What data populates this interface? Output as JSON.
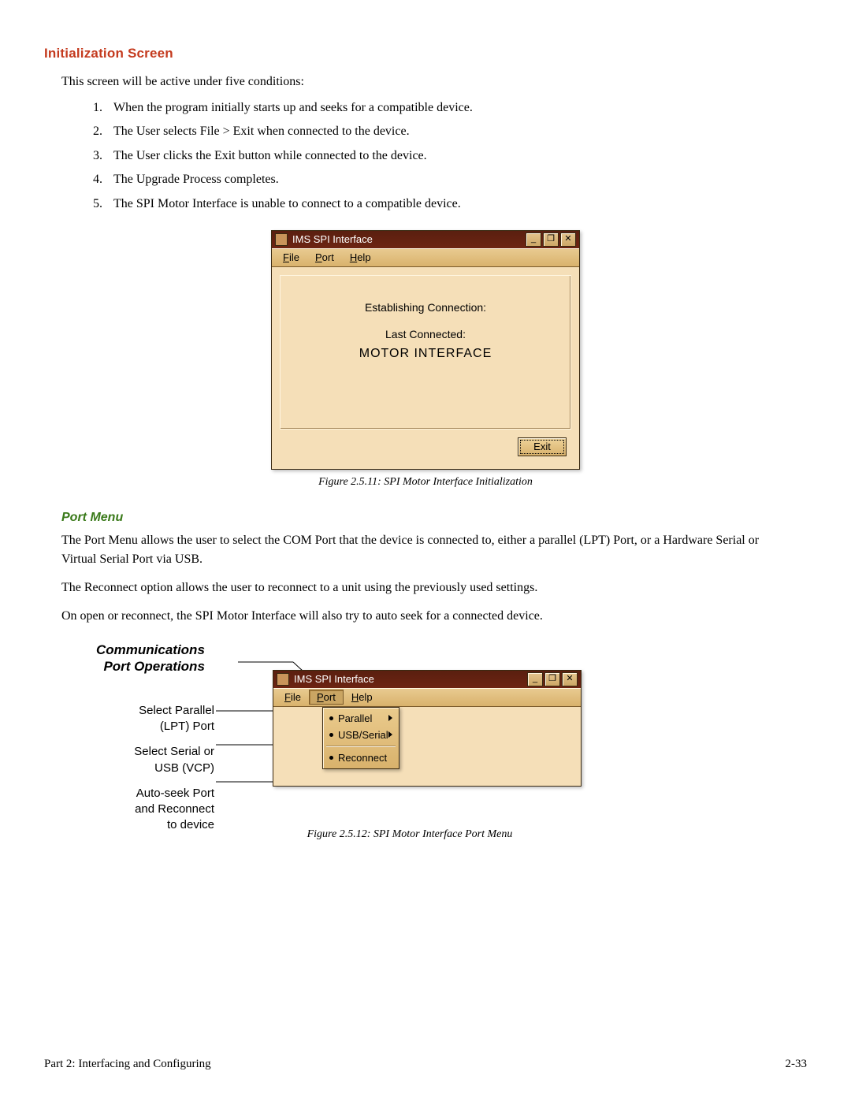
{
  "heading": "Initialization Screen",
  "intro": "This screen will be active under five conditions:",
  "conditions": [
    "When the program initially starts up and seeks for a compatible device.",
    "The User selects File > Exit when connected to the device.",
    "The User clicks the Exit button while connected to the device.",
    "The Upgrade Process completes.",
    "The SPI Motor Interface is unable to connect to a compatible device."
  ],
  "win1": {
    "title": "IMS SPI Interface",
    "menu": {
      "file": "File",
      "port": "Port",
      "help": "Help"
    },
    "line1": "Establishing Connection:",
    "line2": "Last Connected:",
    "line3": "MOTOR INTERFACE",
    "exit": "Exit",
    "min": "_",
    "max": "❐",
    "close": "✕"
  },
  "caption1": "Figure 2.5.11: SPI Motor Interface Initialization",
  "portmenu_heading": "Port Menu",
  "portmenu_p1": "The Port Menu allows the user to select the COM Port that the device is connected to, either a parallel (LPT) Port, or a Hardware Serial or Virtual Serial Port via USB.",
  "portmenu_p2": "The Reconnect option allows the user to reconnect to a unit using the previously used settings.",
  "portmenu_p3": "On open or reconnect, the SPI Motor Interface will also try to auto seek for a connected device.",
  "fig2": {
    "title1": "Communications",
    "title2": "Port Operations",
    "callouts": {
      "a1": "Select Parallel",
      "a2": "(LPT) Port",
      "b1": "Select Serial or",
      "b2": "USB (VCP)",
      "c1": "Auto-seek Port",
      "c2": "and Reconnect",
      "c3": "to device"
    },
    "win_title": "IMS SPI Interface",
    "menu": {
      "file": "File",
      "port": "Port",
      "help": "Help"
    },
    "dd": {
      "parallel": "Parallel",
      "usbserial": "USB/Serial",
      "reconnect": "Reconnect"
    },
    "min": "_",
    "max": "❐",
    "close": "✕"
  },
  "caption2": "Figure 2.5.12: SPI Motor Interface Port Menu",
  "footer_left": "Part 2: Interfacing and Configuring",
  "footer_right": "2-33"
}
